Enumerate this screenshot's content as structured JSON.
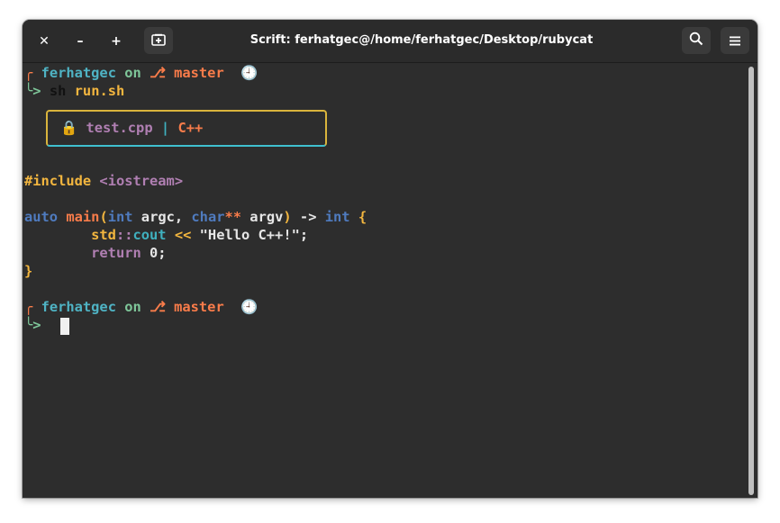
{
  "window": {
    "title": "Scrift: ferhatgec@/home/ferhatgec/Desktop/rubycat",
    "controls": {
      "close": "✕",
      "minimize": "–",
      "maximize": "+"
    },
    "new_tab_icon": "new-tab-icon",
    "search_icon": "search-icon",
    "menu_icon": "hamburger-menu-icon"
  },
  "prompt": {
    "user": "ferhatgec",
    "on": "on",
    "branch_icon": "⎇",
    "branch": "master",
    "clock": "🕘",
    "corner_top": "╭",
    "corner_bottom": "╰>"
  },
  "command": {
    "cmd": "sh",
    "arg": "run.sh"
  },
  "file_badge": {
    "lock": "🔒",
    "filename": "test.cpp",
    "separator": "|",
    "language": "C++"
  },
  "code": {
    "l1": {
      "directive": "#include",
      "header": "<iostream>"
    },
    "l2": {
      "kw_auto": "auto",
      "fn": "main",
      "lparen": "(",
      "t_int": "int",
      "p1": " argc, ",
      "t_char": "char",
      "stars": "**",
      "p2": " argv",
      "rparen": ")",
      "arrow": " ->",
      "ret": " int",
      "brace": " {"
    },
    "l3": {
      "indent": "        ",
      "ns": "std",
      "sep": "::",
      "cout": "cout",
      "op": " << ",
      "str": "\"Hello C++!\"",
      "semi": ";"
    },
    "l4": {
      "indent": "        ",
      "kw_return": "return",
      "rest": " 0;"
    },
    "l5": {
      "brace": "}"
    }
  },
  "colors": {
    "user": "#4fb3c4",
    "on": "#7ec699",
    "branch": "#f97c4a",
    "keyword": "#4f7bbf",
    "preprocessor": "#f3b63f",
    "string": "#e6e6e6",
    "background": "#2d2d2d"
  }
}
